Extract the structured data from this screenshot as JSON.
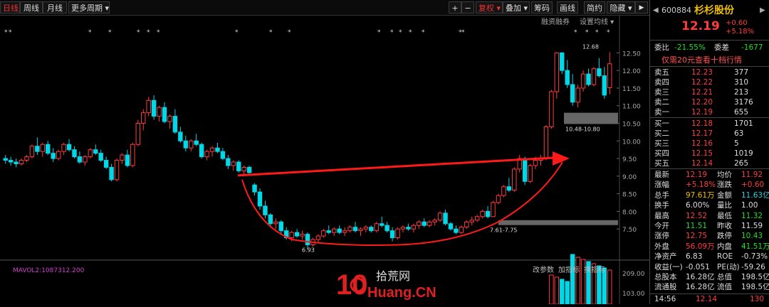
{
  "toolbar": {
    "tabs": [
      "日线",
      "周线",
      "月线",
      "更多周期 ▾"
    ],
    "right_buttons": [
      "+",
      "−",
      "复权 ▾",
      "叠加 ▾",
      "筹码",
      "画线",
      "简约",
      "隐藏 ▾"
    ],
    "sub_labels": [
      "融资融券",
      "设置均线 ▾"
    ]
  },
  "colors": {
    "up": "#ff3c3c",
    "down": "#00d8e8",
    "arrow": "#ff1a1a",
    "bg": "#000000"
  },
  "chart_data": {
    "type": "candlestick",
    "y_ticks": [
      "12.50",
      "12.00",
      "11.50",
      "11.00",
      "10.50",
      "10.00",
      "9.50",
      "9.00",
      "8.50",
      "8.00",
      "7.50"
    ],
    "ylim": [
      7.1,
      12.75
    ],
    "annotations": [
      "12.68",
      "10.48-10.80",
      "7.61-7.75",
      "6.93"
    ],
    "volume_ticks": [
      "209.00",
      "103.00"
    ],
    "candles": [
      [
        9.5,
        9.6,
        9.35,
        9.45
      ],
      [
        9.45,
        9.55,
        9.3,
        9.4
      ],
      [
        9.4,
        9.5,
        9.25,
        9.35
      ],
      [
        9.35,
        9.5,
        9.3,
        9.45
      ],
      [
        9.45,
        9.6,
        9.4,
        9.55
      ],
      [
        9.55,
        9.9,
        9.5,
        9.85
      ],
      [
        9.85,
        10.1,
        9.6,
        9.7
      ],
      [
        9.7,
        9.95,
        9.55,
        9.9
      ],
      [
        9.9,
        10.0,
        9.6,
        9.65
      ],
      [
        9.65,
        9.8,
        9.4,
        9.5
      ],
      [
        9.5,
        9.75,
        9.45,
        9.7
      ],
      [
        9.7,
        9.95,
        9.6,
        9.9
      ],
      [
        9.9,
        10.05,
        9.7,
        9.75
      ],
      [
        9.75,
        9.85,
        9.5,
        9.55
      ],
      [
        9.55,
        9.7,
        9.35,
        9.4
      ],
      [
        9.4,
        9.6,
        9.3,
        9.55
      ],
      [
        9.55,
        9.8,
        9.5,
        9.75
      ],
      [
        9.75,
        9.9,
        9.6,
        9.65
      ],
      [
        9.65,
        9.75,
        9.4,
        9.45
      ],
      [
        9.45,
        9.55,
        9.2,
        9.25
      ],
      [
        9.25,
        9.35,
        8.85,
        8.9
      ],
      [
        8.9,
        9.5,
        8.85,
        9.45
      ],
      [
        9.45,
        9.65,
        9.35,
        9.6
      ],
      [
        9.6,
        9.75,
        9.25,
        9.3
      ],
      [
        9.3,
        9.95,
        9.25,
        9.9
      ],
      [
        9.9,
        10.6,
        9.85,
        10.5
      ],
      [
        10.5,
        10.9,
        10.3,
        10.8
      ],
      [
        10.8,
        11.25,
        10.7,
        11.15
      ],
      [
        11.15,
        11.3,
        10.6,
        10.7
      ],
      [
        10.7,
        11.0,
        10.55,
        10.95
      ],
      [
        10.95,
        11.1,
        10.5,
        10.55
      ],
      [
        10.55,
        10.75,
        10.35,
        10.7
      ],
      [
        10.7,
        10.9,
        10.2,
        10.25
      ],
      [
        10.25,
        10.4,
        9.95,
        10.0
      ],
      [
        10.0,
        10.15,
        9.7,
        9.8
      ],
      [
        9.8,
        10.05,
        9.7,
        10.0
      ],
      [
        10.0,
        10.2,
        9.85,
        9.9
      ],
      [
        9.9,
        9.95,
        9.5,
        9.55
      ],
      [
        9.55,
        9.75,
        9.45,
        9.7
      ],
      [
        9.7,
        9.85,
        9.55,
        9.8
      ],
      [
        9.8,
        9.95,
        9.65,
        9.7
      ],
      [
        9.7,
        9.8,
        9.45,
        9.5
      ],
      [
        9.5,
        9.6,
        9.2,
        9.3
      ],
      [
        9.3,
        9.45,
        9.15,
        9.4
      ],
      [
        9.4,
        9.45,
        9.1,
        9.15
      ],
      [
        9.15,
        9.3,
        9.05,
        9.25
      ],
      [
        9.25,
        9.3,
        9.05,
        9.1
      ],
      [
        8.75,
        8.8,
        8.45,
        8.55
      ],
      [
        8.55,
        8.65,
        8.05,
        8.15
      ],
      [
        8.15,
        8.3,
        7.8,
        7.9
      ],
      [
        7.9,
        7.95,
        7.55,
        7.65
      ],
      [
        7.65,
        7.8,
        7.5,
        7.7
      ],
      [
        7.7,
        7.75,
        7.35,
        7.45
      ],
      [
        7.45,
        7.55,
        7.2,
        7.25
      ],
      [
        7.25,
        7.45,
        7.15,
        7.4
      ],
      [
        7.4,
        7.5,
        7.25,
        7.3
      ],
      [
        7.3,
        7.45,
        7.2,
        7.35
      ],
      [
        7.35,
        7.4,
        6.93,
        7.05
      ],
      [
        7.05,
        7.25,
        7.0,
        7.2
      ],
      [
        7.2,
        7.35,
        7.1,
        7.3
      ],
      [
        7.3,
        7.5,
        7.25,
        7.45
      ],
      [
        7.45,
        7.6,
        7.35,
        7.4
      ],
      [
        7.4,
        7.55,
        7.3,
        7.5
      ],
      [
        7.5,
        7.6,
        7.35,
        7.4
      ],
      [
        7.4,
        7.55,
        7.3,
        7.45
      ],
      [
        7.45,
        7.6,
        7.4,
        7.55
      ],
      [
        7.55,
        7.7,
        7.4,
        7.45
      ],
      [
        7.45,
        7.55,
        7.3,
        7.5
      ],
      [
        7.5,
        7.6,
        7.4,
        7.55
      ],
      [
        7.55,
        7.6,
        7.4,
        7.45
      ],
      [
        7.45,
        7.7,
        7.4,
        7.65
      ],
      [
        7.65,
        7.85,
        7.55,
        7.6
      ],
      [
        7.6,
        7.7,
        7.4,
        7.45
      ],
      [
        7.45,
        7.55,
        7.15,
        7.25
      ],
      [
        7.25,
        7.55,
        7.2,
        7.5
      ],
      [
        7.5,
        7.6,
        7.4,
        7.55
      ],
      [
        7.55,
        7.65,
        7.45,
        7.5
      ],
      [
        7.5,
        7.65,
        7.4,
        7.6
      ],
      [
        7.6,
        7.75,
        7.5,
        7.7
      ],
      [
        7.7,
        7.8,
        7.55,
        7.6
      ],
      [
        7.6,
        7.75,
        7.55,
        7.7
      ],
      [
        7.7,
        7.8,
        7.6,
        7.75
      ],
      [
        7.75,
        8.0,
        7.7,
        7.95
      ],
      [
        7.95,
        8.05,
        7.6,
        7.65
      ],
      [
        7.65,
        7.7,
        7.45,
        7.5
      ],
      [
        7.5,
        7.6,
        7.35,
        7.4
      ],
      [
        7.4,
        7.6,
        7.35,
        7.55
      ],
      [
        7.55,
        7.75,
        7.5,
        7.7
      ],
      [
        7.7,
        7.85,
        7.6,
        7.75
      ],
      [
        7.75,
        7.9,
        7.7,
        7.85
      ],
      [
        7.85,
        8.05,
        7.8,
        8.0
      ],
      [
        8.0,
        8.15,
        7.8,
        7.85
      ],
      [
        7.85,
        8.3,
        7.85,
        8.25
      ],
      [
        8.25,
        8.5,
        8.2,
        8.45
      ],
      [
        8.45,
        8.75,
        8.4,
        8.7
      ],
      [
        8.7,
        8.95,
        8.55,
        8.6
      ],
      [
        8.6,
        9.25,
        8.55,
        9.2
      ],
      [
        9.2,
        9.6,
        9.1,
        9.5
      ],
      [
        9.5,
        9.55,
        8.75,
        8.85
      ],
      [
        8.85,
        9.35,
        8.8,
        9.3
      ],
      [
        9.3,
        9.55,
        9.2,
        9.45
      ],
      [
        9.45,
        9.6,
        9.3,
        9.5
      ],
      [
        9.5,
        10.45,
        9.45,
        10.4
      ],
      [
        10.4,
        11.45,
        10.35,
        11.4
      ],
      [
        11.4,
        12.52,
        11.2,
        12.5
      ],
      [
        12.5,
        12.52,
        11.9,
        12.0
      ],
      [
        12.0,
        12.3,
        11.5,
        11.6
      ],
      [
        11.6,
        11.9,
        11.0,
        11.1
      ],
      [
        11.1,
        11.6,
        10.95,
        11.5
      ],
      [
        11.5,
        12.0,
        11.4,
        11.9
      ],
      [
        11.9,
        12.05,
        11.55,
        11.6
      ],
      [
        11.6,
        12.1,
        11.55,
        12.05
      ],
      [
        12.05,
        12.35,
        11.8,
        11.85
      ],
      [
        11.85,
        12.1,
        11.2,
        11.3
      ],
      [
        11.51,
        12.52,
        11.32,
        12.19
      ]
    ]
  },
  "indicator": {
    "label": "MAVOL2:1087312.200",
    "buttons": [
      "改参数",
      "加指标",
      "换指标"
    ]
  },
  "quote": {
    "code": "600884",
    "name": "杉杉股份",
    "price": "12.19",
    "change": "+0.60",
    "change_pct": "+5.18%",
    "weibi_label": "委比",
    "weibi": "-21.55%",
    "weicha_label": "委差",
    "weicha": "-1677",
    "promo": "仅需20元查看十档行情",
    "asks": [
      {
        "label": "卖五",
        "price": "12.23",
        "vol": "377"
      },
      {
        "label": "卖四",
        "price": "12.22",
        "vol": "310"
      },
      {
        "label": "卖三",
        "price": "12.21",
        "vol": "213"
      },
      {
        "label": "卖二",
        "price": "12.20",
        "vol": "3176"
      },
      {
        "label": "卖一",
        "price": "12.19",
        "vol": "655"
      }
    ],
    "bids": [
      {
        "label": "买一",
        "price": "12.18",
        "vol": "1701"
      },
      {
        "label": "买二",
        "price": "12.17",
        "vol": "63"
      },
      {
        "label": "买三",
        "price": "12.16",
        "vol": "5"
      },
      {
        "label": "买四",
        "price": "12.15",
        "vol": "1019"
      },
      {
        "label": "买五",
        "price": "12.14",
        "vol": "265"
      }
    ],
    "stats": [
      [
        {
          "l": "最新",
          "v": "12.19",
          "c": "red"
        },
        {
          "l": "均价",
          "v": "11.92",
          "c": "red"
        }
      ],
      [
        {
          "l": "涨幅",
          "v": "+5.18%",
          "c": "red"
        },
        {
          "l": "涨跌",
          "v": "+0.60",
          "c": "red"
        }
      ],
      [
        {
          "l": "总手",
          "v": "97.61万",
          "c": "yel"
        },
        {
          "l": "金额",
          "v": "11.63亿",
          "c": "cyan"
        }
      ],
      [
        {
          "l": "换手",
          "v": "6.00%",
          "c": "wht"
        },
        {
          "l": "量比",
          "v": "1.00",
          "c": "wht"
        }
      ],
      [
        {
          "l": "最高",
          "v": "12.52",
          "c": "red"
        },
        {
          "l": "最低",
          "v": "11.32",
          "c": "green"
        }
      ],
      [
        {
          "l": "今开",
          "v": "11.51",
          "c": "green"
        },
        {
          "l": "昨收",
          "v": "11.59",
          "c": "wht"
        }
      ],
      [
        {
          "l": "涨停",
          "v": "12.75",
          "c": "red"
        },
        {
          "l": "跌停",
          "v": "10.43",
          "c": "green"
        }
      ],
      [
        {
          "l": "外盘",
          "v": "56.09万",
          "c": "red"
        },
        {
          "l": "内盘",
          "v": "41.51万",
          "c": "green"
        }
      ],
      [
        {
          "l": "净资产",
          "v": "6.83",
          "c": "wht"
        },
        {
          "l": "ROE",
          "v": "-0.73%",
          "c": "wht"
        }
      ],
      [
        {
          "l": "收益(一)",
          "v": "-0.051",
          "c": "wht"
        },
        {
          "l": "PE(动)",
          "v": "-59.26",
          "c": "wht"
        }
      ],
      [
        {
          "l": "总股本",
          "v": "16.28亿",
          "c": "wht"
        },
        {
          "l": "总值",
          "v": "198.5亿",
          "c": "wht"
        }
      ],
      [
        {
          "l": "流通股",
          "v": "16.28亿",
          "c": "wht"
        },
        {
          "l": "流值",
          "v": "198.5亿",
          "c": "wht"
        }
      ]
    ],
    "tick": {
      "time": "14:56",
      "price": "12.14",
      "vol": "130"
    }
  },
  "watermark": {
    "line1": "拾荒网",
    "line2": "Huang.CN",
    "num": "10"
  }
}
